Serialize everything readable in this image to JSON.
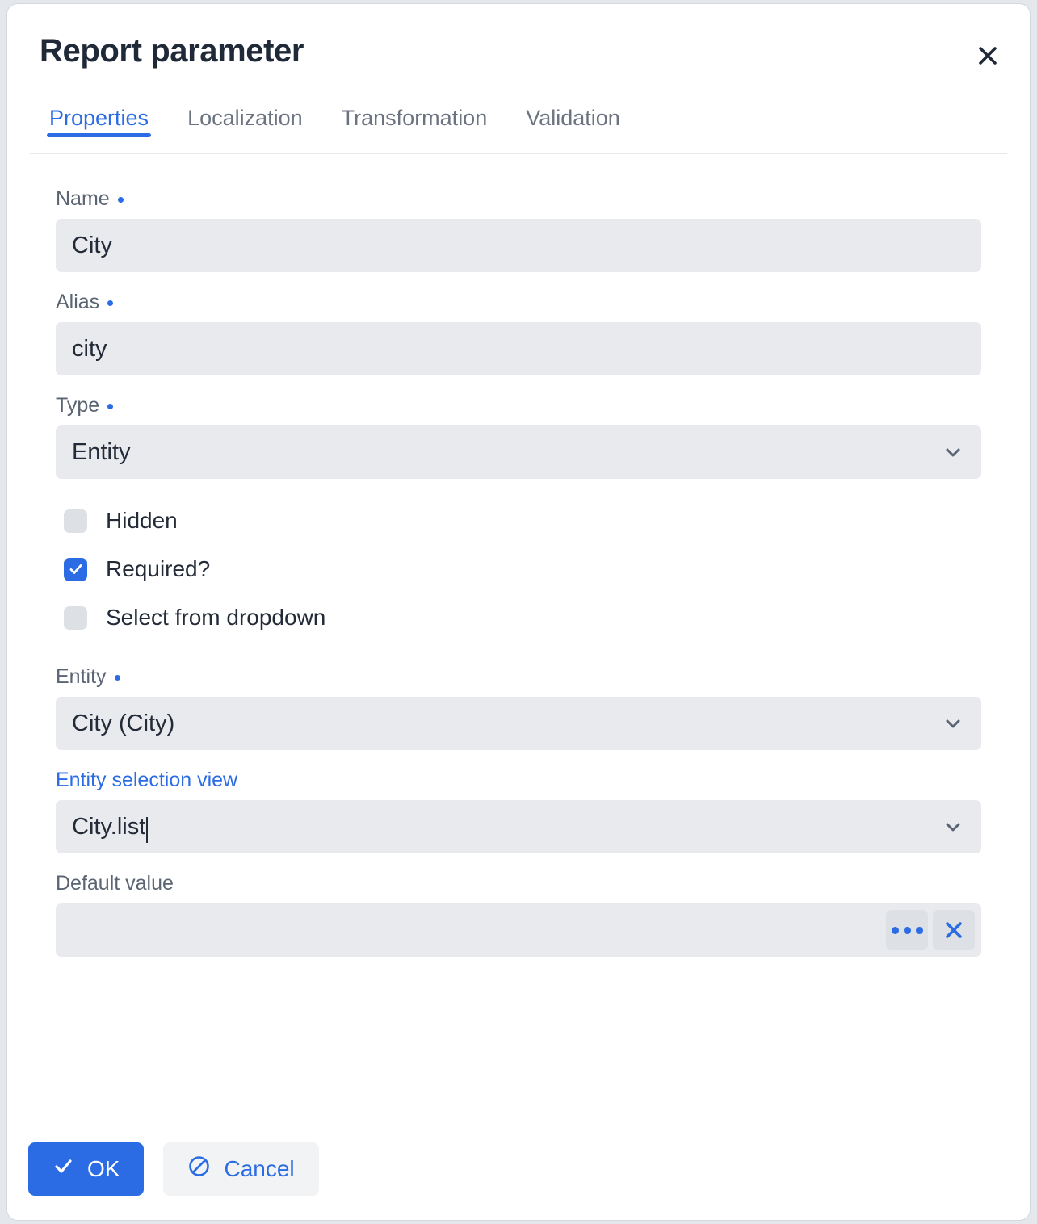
{
  "dialog": {
    "title": "Report parameter",
    "close_icon": "close-icon"
  },
  "tabs": [
    {
      "label": "Properties",
      "active": true
    },
    {
      "label": "Localization",
      "active": false
    },
    {
      "label": "Transformation",
      "active": false
    },
    {
      "label": "Validation",
      "active": false
    }
  ],
  "fields": {
    "name": {
      "label": "Name",
      "value": "City",
      "required": true
    },
    "alias": {
      "label": "Alias",
      "value": "city",
      "required": true
    },
    "type": {
      "label": "Type",
      "value": "Entity",
      "required": true,
      "control": "select"
    },
    "entity": {
      "label": "Entity",
      "value": "City (City)",
      "required": true,
      "control": "select"
    },
    "entity_selection_view": {
      "label": "Entity selection view",
      "value": "City.list",
      "required": false,
      "control": "select",
      "label_is_link": true,
      "focused": true
    },
    "default_value": {
      "label": "Default value",
      "value": "",
      "required": false
    }
  },
  "checkboxes": [
    {
      "label": "Hidden",
      "checked": false
    },
    {
      "label": "Required?",
      "checked": true
    },
    {
      "label": "Select from dropdown",
      "checked": false
    }
  ],
  "field_actions": [
    {
      "name": "ellipsis-button",
      "icon": "ellipsis-icon"
    },
    {
      "name": "clear-button",
      "icon": "close-icon"
    }
  ],
  "footer": {
    "ok_label": "OK",
    "cancel_label": "Cancel"
  },
  "colors": {
    "accent": "#2b6ce4",
    "input_bg": "#e8eaee",
    "label": "#5b6472",
    "text": "#242b38"
  }
}
